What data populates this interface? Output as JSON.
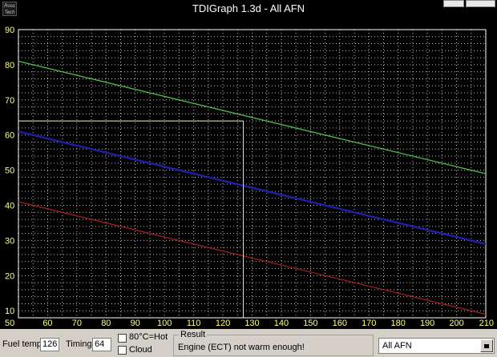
{
  "window": {
    "title": "TDIGraph 1.3d - All AFN",
    "icon_text_top": "Ross",
    "icon_text_bottom": "Tech"
  },
  "chart_data": {
    "type": "line",
    "title": "",
    "xlabel": "",
    "ylabel": "",
    "xlim": [
      50,
      210
    ],
    "ylim": [
      8,
      90
    ],
    "x_ticks": [
      50,
      60,
      70,
      80,
      90,
      100,
      110,
      120,
      130,
      140,
      150,
      160,
      170,
      180,
      190,
      200,
      210
    ],
    "y_ticks": [
      10,
      20,
      30,
      40,
      50,
      60,
      70,
      80,
      90
    ],
    "grid": true,
    "background": "#000000",
    "axis_color": "#ffffff",
    "tick_label_color": "#ffff80",
    "series": [
      {
        "color": "#4fbf4f",
        "x": [
          50,
          210
        ],
        "y": [
          81,
          49
        ]
      },
      {
        "color": "#1f1fa0",
        "x": [
          50,
          210
        ],
        "y": [
          61,
          29
        ]
      },
      {
        "color": "#a02020",
        "x": [
          50,
          210
        ],
        "y": [
          41,
          9
        ]
      }
    ],
    "marker": {
      "color": "#f0f0a0",
      "x": 127,
      "y": 64
    }
  },
  "controls": {
    "fuel_temp_label": "Fuel temp",
    "fuel_temp_value": "126",
    "timing_label": "Timing",
    "timing_value": "64",
    "checkbox_hot_label": "80°C=Hot",
    "checkbox_cloud_label": "Cloud",
    "result_title": "Result",
    "result_text": "Engine (ECT) not warm enough!",
    "engine_select_value": "All AFN"
  }
}
